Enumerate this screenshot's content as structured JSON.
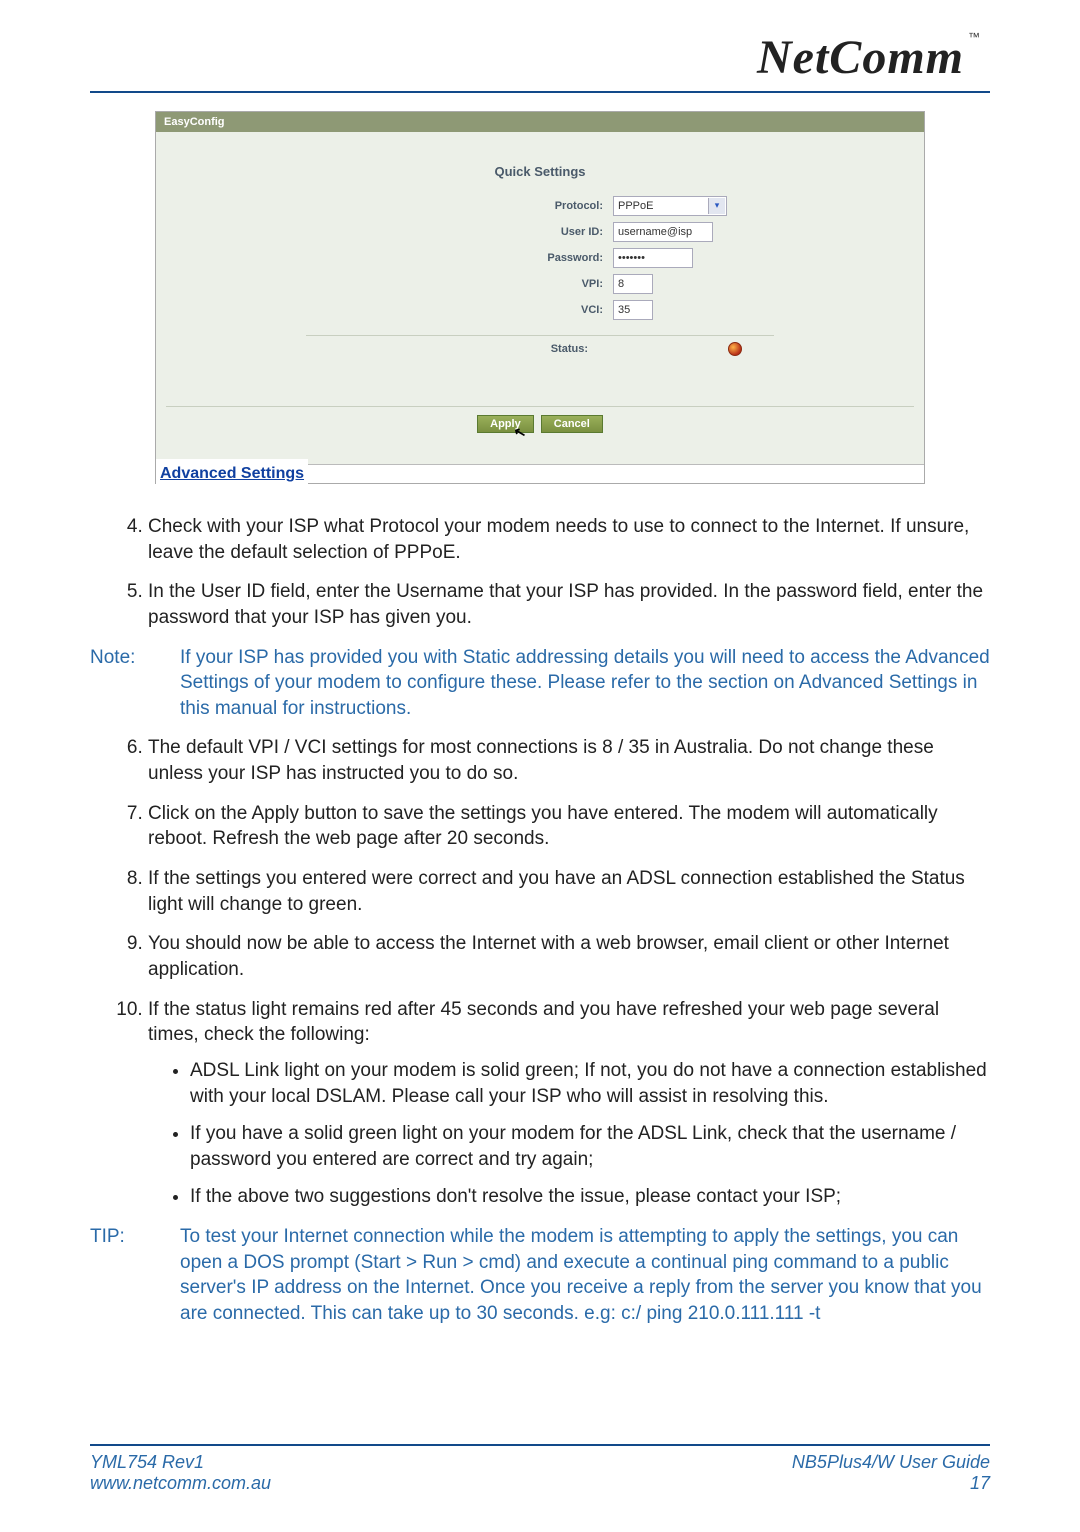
{
  "brand": {
    "name": "NetComm",
    "tm": "™"
  },
  "app": {
    "header": "EasyConfig",
    "section_title": "Quick Settings",
    "labels": {
      "protocol": "Protocol:",
      "userid": "User ID:",
      "password": "Password:",
      "vpi": "VPI:",
      "vci": "VCI:",
      "status": "Status:"
    },
    "values": {
      "protocol": "PPPoE",
      "userid": "username@isp",
      "password": "•••••••",
      "vpi": "8",
      "vci": "35"
    },
    "buttons": {
      "apply": "Apply",
      "cancel": "Cancel"
    },
    "advanced": "Advanced Settings"
  },
  "steps": {
    "4": "Check with your ISP what Protocol your modem needs to use to connect to the Internet. If unsure, leave the default selection of PPPoE.",
    "5": "In the User ID field, enter the Username that your ISP has provided. In the password field, enter the password that your ISP has given you.",
    "6": "The default VPI / VCI settings for most connections is 8 / 35 in Australia. Do not change these unless your ISP has instructed you to do so.",
    "7": "Click on the Apply button to save the settings you have entered. The modem will automatically reboot. Refresh the web page after 20 seconds.",
    "8": "If the settings you entered were correct and you have an ADSL connection established the Status light will change to green.",
    "9": "You should now be able to access the Internet with a web browser, email client or other Internet application.",
    "10": "If the status light remains red after 45 seconds and you have refreshed your web page several times, check the following:"
  },
  "sublist": {
    "a": "ADSL Link light on your modem is solid green; If not, you do not have a connection established with your local DSLAM. Please call your ISP who will assist in resolving this.",
    "b": "If you have a solid green light on your modem for the ADSL Link, check that the username / password you entered are correct and try again;",
    "c": "If the above two suggestions don't resolve the issue, please contact your ISP;"
  },
  "note": {
    "label": "Note:",
    "text": "If your ISP has provided you with Static addressing details you will need to access the Advanced Settings of your modem to configure these. Please refer to the section on Advanced Settings in this manual for instructions."
  },
  "tip": {
    "label": "TIP:",
    "text": "To test your Internet connection while the modem is attempting to apply the settings, you can open a DOS prompt (Start > Run > cmd) and execute a continual ping command to a public server's IP address on the Internet. Once you receive a reply from the server you know that you are connected. This can take up to 30 seconds. e.g:  c:/  ping 210.0.111.111 -t"
  },
  "footer": {
    "rev": "YML754 Rev1",
    "url": "www.netcomm.com.au",
    "guide": "NB5Plus4/W User Guide",
    "page": "17"
  }
}
